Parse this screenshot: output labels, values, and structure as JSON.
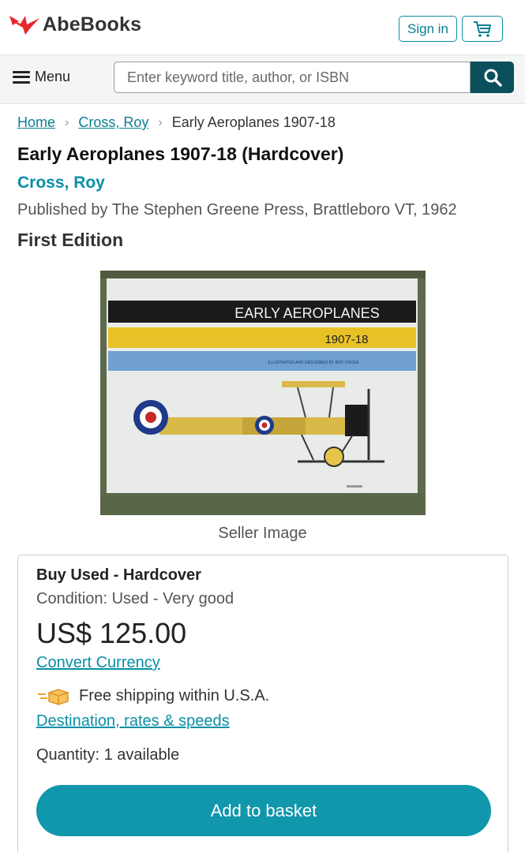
{
  "header": {
    "logo_text": "AbeBooks",
    "sign_in_label": "Sign in",
    "cart_icon": "cart-icon"
  },
  "nav": {
    "menu_label": "Menu",
    "search_placeholder": "Enter keyword title, author, or ISBN",
    "search_icon": "search-icon"
  },
  "breadcrumb": {
    "home": "Home",
    "author": "Cross, Roy",
    "current": "Early Aeroplanes 1907-18"
  },
  "product": {
    "title": "Early Aeroplanes 1907-18 (Hardcover)",
    "author": "Cross, Roy",
    "publisher": "Published by The Stephen Greene Press, Brattleboro VT, 1962",
    "edition": "First Edition",
    "image_caption": "Seller Image",
    "cover": {
      "title": "EARLY AEROPLANES",
      "years": "1907-18",
      "subtitle": "ILLUSTRATED AND DESCRIBED BY ROY CROSS"
    }
  },
  "buy": {
    "heading": "Buy Used - Hardcover",
    "condition": "Condition: Used - Very good",
    "price": "US$ 125.00",
    "convert_currency": "Convert Currency",
    "shipping": "Free shipping within U.S.A.",
    "destination_link": "Destination, rates & speeds",
    "quantity": "Quantity: 1 available",
    "add_to_basket": "Add to basket"
  },
  "colors": {
    "accent": "#0a8fa6",
    "search_button": "#0b4f5c",
    "button": "#1097ac",
    "logo_red": "#e8262e"
  }
}
